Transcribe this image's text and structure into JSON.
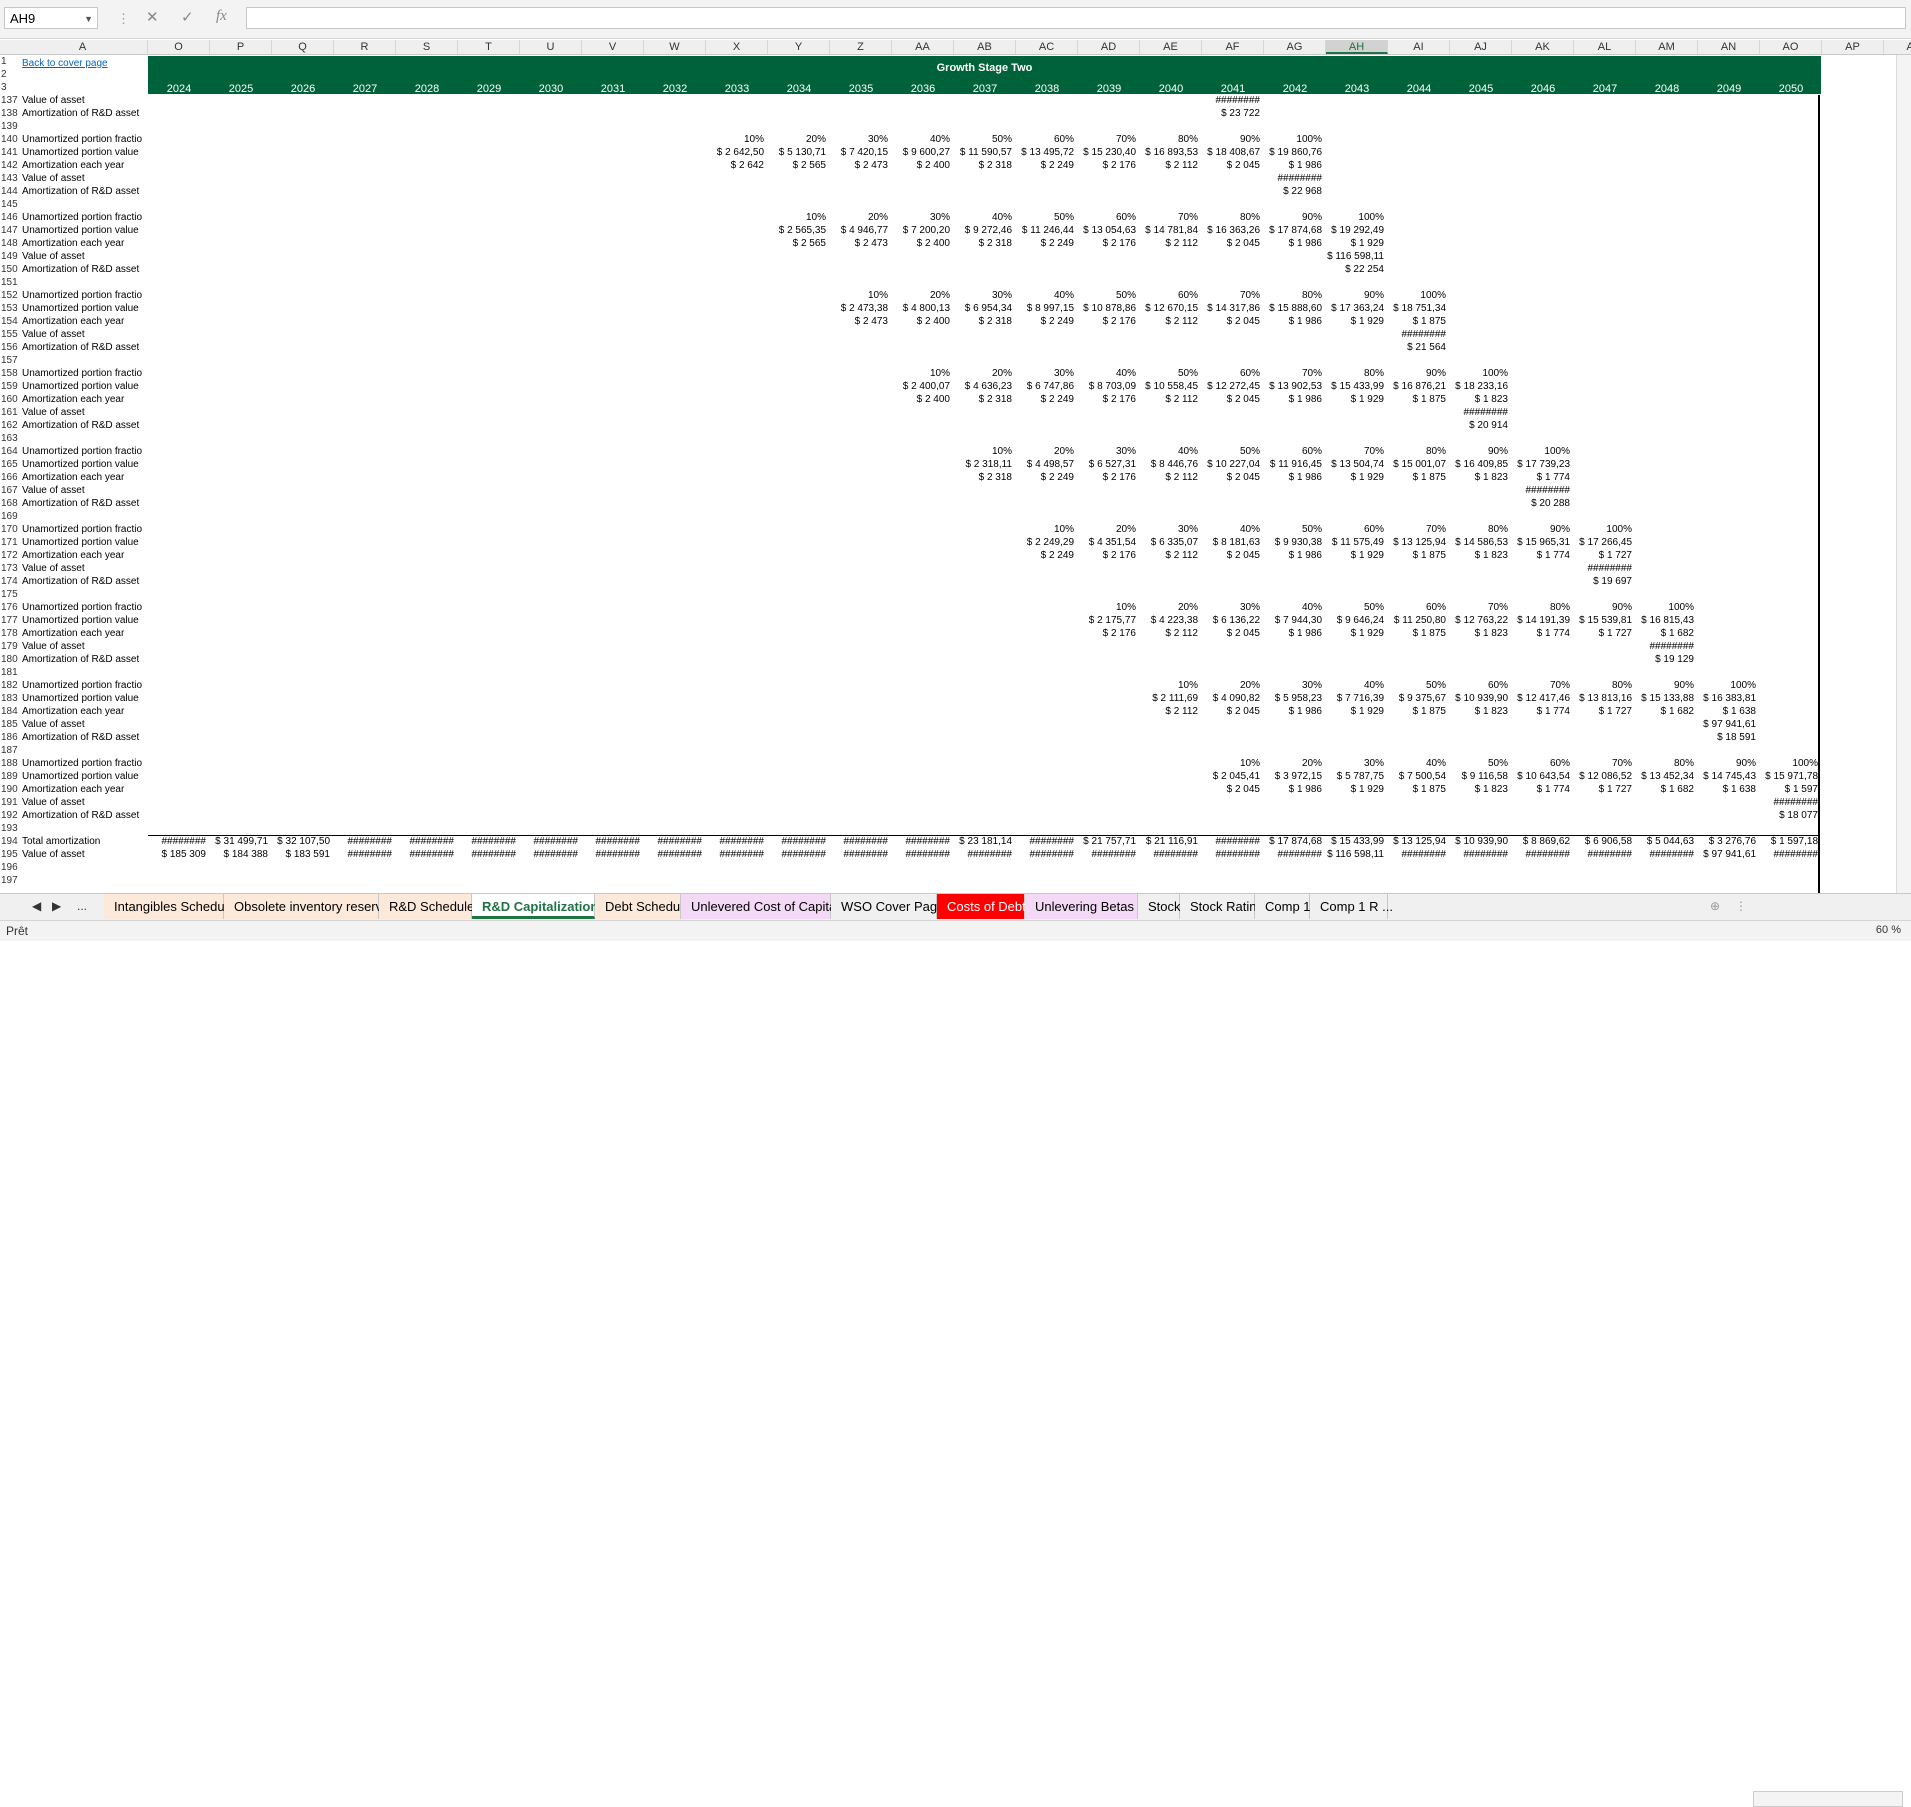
{
  "name_box": "AH9",
  "status": "Prêt",
  "zoom": "60 %",
  "back_link": "Back to cover page",
  "banner_title": "Growth Stage Two",
  "columns": [
    "A",
    "O",
    "P",
    "Q",
    "R",
    "S",
    "T",
    "U",
    "V",
    "W",
    "X",
    "Y",
    "Z",
    "AA",
    "AB",
    "AC",
    "AD",
    "AE",
    "AF",
    "AG",
    "AH",
    "AI",
    "AJ",
    "AK",
    "AL",
    "AM",
    "AN",
    "AO",
    "AP",
    "AQ"
  ],
  "selected_column": "AH",
  "years": [
    "2024",
    "2025",
    "2026",
    "2027",
    "2028",
    "2029",
    "2030",
    "2031",
    "2032",
    "2033",
    "2034",
    "2035",
    "2036",
    "2037",
    "2038",
    "2039",
    "2040",
    "2041",
    "2042",
    "2043",
    "2044",
    "2045",
    "2046",
    "2047",
    "2048",
    "2049",
    "2050"
  ],
  "row_numbers": [
    "1",
    "2",
    "3",
    "137",
    "138",
    "139",
    "140",
    "141",
    "142",
    "143",
    "144",
    "145",
    "146",
    "147",
    "148",
    "149",
    "150",
    "151",
    "152",
    "153",
    "154",
    "155",
    "156",
    "157",
    "158",
    "159",
    "160",
    "161",
    "162",
    "163",
    "164",
    "165",
    "166",
    "167",
    "168",
    "169",
    "170",
    "171",
    "172",
    "173",
    "174",
    "175",
    "176",
    "177",
    "178",
    "179",
    "180",
    "181",
    "182",
    "183",
    "184",
    "185",
    "186",
    "187",
    "188",
    "189",
    "190",
    "191",
    "192",
    "193",
    "194",
    "195",
    "196",
    "197"
  ],
  "labels": {
    "r137": "Value of asset",
    "r138": "Amortization of R&D asset",
    "frac": "Unamortized portion fractio",
    "val": "Unamortized portion value",
    "each": "Amortization each year",
    "asset": "Value of asset",
    "amort": "Amortization of R&D asset",
    "total_amort": "Total amortization",
    "total_value": "Value of asset"
  },
  "top": {
    "r137": "########",
    "r138": "$   23 722"
  },
  "blocks": [
    {
      "frac": [
        "10%",
        "20%",
        "30%",
        "40%",
        "50%",
        "60%",
        "70%",
        "80%",
        "90%",
        "100%"
      ],
      "val": [
        "$ 2 642,50",
        "$  5 130,71",
        "$  7 420,15",
        "$  9 600,27",
        "$ 11 590,57",
        "$ 13 495,72",
        "$ 15 230,40",
        "$ 16 893,53",
        "$ 18 408,67",
        "$ 19 860,76"
      ],
      "each": [
        "$     2 642",
        "$     2 565",
        "$     2 473",
        "$     2 400",
        "$     2 318",
        "$     2 249",
        "$     2 176",
        "$     2 112",
        "$     2 045",
        "$     1 986"
      ],
      "asset": "########",
      "amort": "$   22 968"
    },
    {
      "frac": [
        "10%",
        "20%",
        "30%",
        "40%",
        "50%",
        "60%",
        "70%",
        "80%",
        "90%",
        "100%"
      ],
      "val": [
        "$ 2 565,35",
        "$  4 946,77",
        "$  7 200,20",
        "$  9 272,46",
        "$ 11 246,44",
        "$ 13 054,63",
        "$ 14 781,84",
        "$ 16 363,26",
        "$ 17 874,68",
        "$ 19 292,49"
      ],
      "each": [
        "$     2 565",
        "$     2 473",
        "$     2 400",
        "$     2 318",
        "$     2 249",
        "$     2 176",
        "$     2 112",
        "$     2 045",
        "$     1 986",
        "$     1 929"
      ],
      "asset": "$ 116 598,11",
      "amort": "$   22 254"
    },
    {
      "frac": [
        "10%",
        "20%",
        "30%",
        "40%",
        "50%",
        "60%",
        "70%",
        "80%",
        "90%",
        "100%"
      ],
      "val": [
        "$ 2 473,38",
        "$  4 800,13",
        "$  6 954,34",
        "$  8 997,15",
        "$ 10 878,86",
        "$ 12 670,15",
        "$ 14 317,86",
        "$ 15 888,60",
        "$ 17 363,24",
        "$ 18 751,34"
      ],
      "each": [
        "$     2 473",
        "$     2 400",
        "$     2 318",
        "$     2 249",
        "$     2 176",
        "$     2 112",
        "$     2 045",
        "$     1 986",
        "$     1 929",
        "$     1 875"
      ],
      "asset": "########",
      "amort": "$   21 564"
    },
    {
      "frac": [
        "10%",
        "20%",
        "30%",
        "40%",
        "50%",
        "60%",
        "70%",
        "80%",
        "90%",
        "100%"
      ],
      "val": [
        "$ 2 400,07",
        "$  4 636,23",
        "$  6 747,86",
        "$  8 703,09",
        "$ 10 558,45",
        "$ 12 272,45",
        "$ 13 902,53",
        "$ 15 433,99",
        "$ 16 876,21",
        "$ 18 233,16"
      ],
      "each": [
        "$     2 400",
        "$     2 318",
        "$     2 249",
        "$     2 176",
        "$     2 112",
        "$     2 045",
        "$     1 986",
        "$     1 929",
        "$     1 875",
        "$     1 823"
      ],
      "asset": "########",
      "amort": "$   20 914"
    },
    {
      "frac": [
        "10%",
        "20%",
        "30%",
        "40%",
        "50%",
        "60%",
        "70%",
        "80%",
        "90%",
        "100%"
      ],
      "val": [
        "$ 2 318,11",
        "$  4 498,57",
        "$  6 527,31",
        "$  8 446,76",
        "$ 10 227,04",
        "$ 11 916,45",
        "$ 13 504,74",
        "$ 15 001,07",
        "$ 16 409,85",
        "$ 17 739,23"
      ],
      "each": [
        "$     2 318",
        "$     2 249",
        "$     2 176",
        "$     2 112",
        "$     2 045",
        "$     1 986",
        "$     1 929",
        "$     1 875",
        "$     1 823",
        "$     1 774"
      ],
      "asset": "########",
      "amort": "$   20 288"
    },
    {
      "frac": [
        "10%",
        "20%",
        "30%",
        "40%",
        "50%",
        "60%",
        "70%",
        "80%",
        "90%",
        "100%"
      ],
      "val": [
        "$ 2 249,29",
        "$  4 351,54",
        "$  6 335,07",
        "$  8 181,63",
        "$  9 930,38",
        "$ 11 575,49",
        "$ 13 125,94",
        "$ 14 586,53",
        "$ 15 965,31",
        "$ 17 266,45"
      ],
      "each": [
        "$     2 249",
        "$     2 176",
        "$     2 112",
        "$     2 045",
        "$     1 986",
        "$     1 929",
        "$     1 875",
        "$     1 823",
        "$     1 774",
        "$     1 727"
      ],
      "asset": "########",
      "amort": "$   19 697"
    },
    {
      "frac": [
        "10%",
        "20%",
        "30%",
        "40%",
        "50%",
        "60%",
        "70%",
        "80%",
        "90%",
        "100%"
      ],
      "val": [
        "$ 2 175,77",
        "$  4 223,38",
        "$  6 136,22",
        "$  7 944,30",
        "$  9 646,24",
        "$ 11 250,80",
        "$ 12 763,22",
        "$ 14 191,39",
        "$ 15 539,81",
        "$ 16 815,43"
      ],
      "each": [
        "$     2 176",
        "$     2 112",
        "$     2 045",
        "$     1 986",
        "$     1 929",
        "$     1 875",
        "$     1 823",
        "$     1 774",
        "$     1 727",
        "$     1 682"
      ],
      "asset": "########",
      "amort": "$   19 129"
    },
    {
      "frac": [
        "10%",
        "20%",
        "30%",
        "40%",
        "50%",
        "60%",
        "70%",
        "80%",
        "90%",
        "100%"
      ],
      "val": [
        "$ 2 111,69",
        "$  4 090,82",
        "$  5 958,23",
        "$  7 716,39",
        "$  9 375,67",
        "$ 10 939,90",
        "$ 12 417,46",
        "$ 13 813,16",
        "$ 15 133,88",
        "$ 16 383,81"
      ],
      "each": [
        "$     2 112",
        "$     2 045",
        "$     1 986",
        "$     1 929",
        "$     1 875",
        "$     1 823",
        "$     1 774",
        "$     1 727",
        "$     1 682",
        "$     1 638"
      ],
      "asset": "$ 97 941,61",
      "amort": "$   18 591"
    },
    {
      "frac": [
        "10%",
        "20%",
        "30%",
        "40%",
        "50%",
        "60%",
        "70%",
        "80%",
        "90%",
        "100%"
      ],
      "val": [
        "$ 2 045,41",
        "$  3 972,15",
        "$  5 787,75",
        "$  7 500,54",
        "$  9 116,58",
        "$ 10 643,54",
        "$ 12 086,52",
        "$ 13 452,34",
        "$ 14 745,43",
        "$ 15 971,78"
      ],
      "each": [
        "$     2 045",
        "$     1 986",
        "$     1 929",
        "$     1 875",
        "$     1 823",
        "$     1 774",
        "$     1 727",
        "$     1 682",
        "$     1 638",
        "$     1 597"
      ],
      "asset": "########",
      "amort": "$   18 077"
    }
  ],
  "total_amort": [
    "########",
    "$ 31 499,71",
    "$ 32 107,50",
    "########",
    "########",
    "########",
    "########",
    "########",
    "########",
    "########",
    "########",
    "########",
    "########",
    "$ 23 181,14",
    "########",
    "$ 21 757,71",
    "$ 21 116,91",
    "########",
    "$ 17 874,68",
    "$ 15 433,99",
    "$ 13 125,94",
    "$ 10 939,90",
    "$ 8 869,62",
    "$ 6 906,58",
    "$ 5 044,63",
    "$ 3 276,76",
    "$ 1 597,18"
  ],
  "total_value": [
    "$  185 309",
    "$  184 388",
    "$  183 591",
    "########",
    "########",
    "########",
    "########",
    "########",
    "########",
    "########",
    "########",
    "########",
    "########",
    "########",
    "########",
    "########",
    "########",
    "########",
    "########",
    "$ 116 598,11",
    "########",
    "########",
    "########",
    "########",
    "########",
    "$ 97 941,61",
    "########"
  ],
  "sheet_tabs": [
    {
      "label": "Intangibles Schedule",
      "color": "#fde9d9"
    },
    {
      "label": "Obsolete inventory reserve",
      "color": "#fde9d9"
    },
    {
      "label": "R&D Schedule",
      "color": "#fde9d9"
    },
    {
      "label": "R&D Capitalization",
      "color": "#ffffff"
    },
    {
      "label": "Debt Schedule",
      "color": "#fde9d9"
    },
    {
      "label": "Unlevered Cost of Capital",
      "color": "#f3d9f5"
    },
    {
      "label": "WSO Cover Page",
      "color": "#f0f0f0"
    },
    {
      "label": "Costs of Debt",
      "color": "#ff0000"
    },
    {
      "label": "Unlevering Betas",
      "color": "#f3d9f5"
    },
    {
      "label": "Stock",
      "color": "#f0f0f0"
    },
    {
      "label": "Stock Rating",
      "color": "#f0f0f0"
    },
    {
      "label": "Comp 1",
      "color": "#f0f0f0"
    },
    {
      "label": "Comp 1 R ...",
      "color": "#f0f0f0"
    }
  ],
  "active_tab": "R&D Capitalization"
}
